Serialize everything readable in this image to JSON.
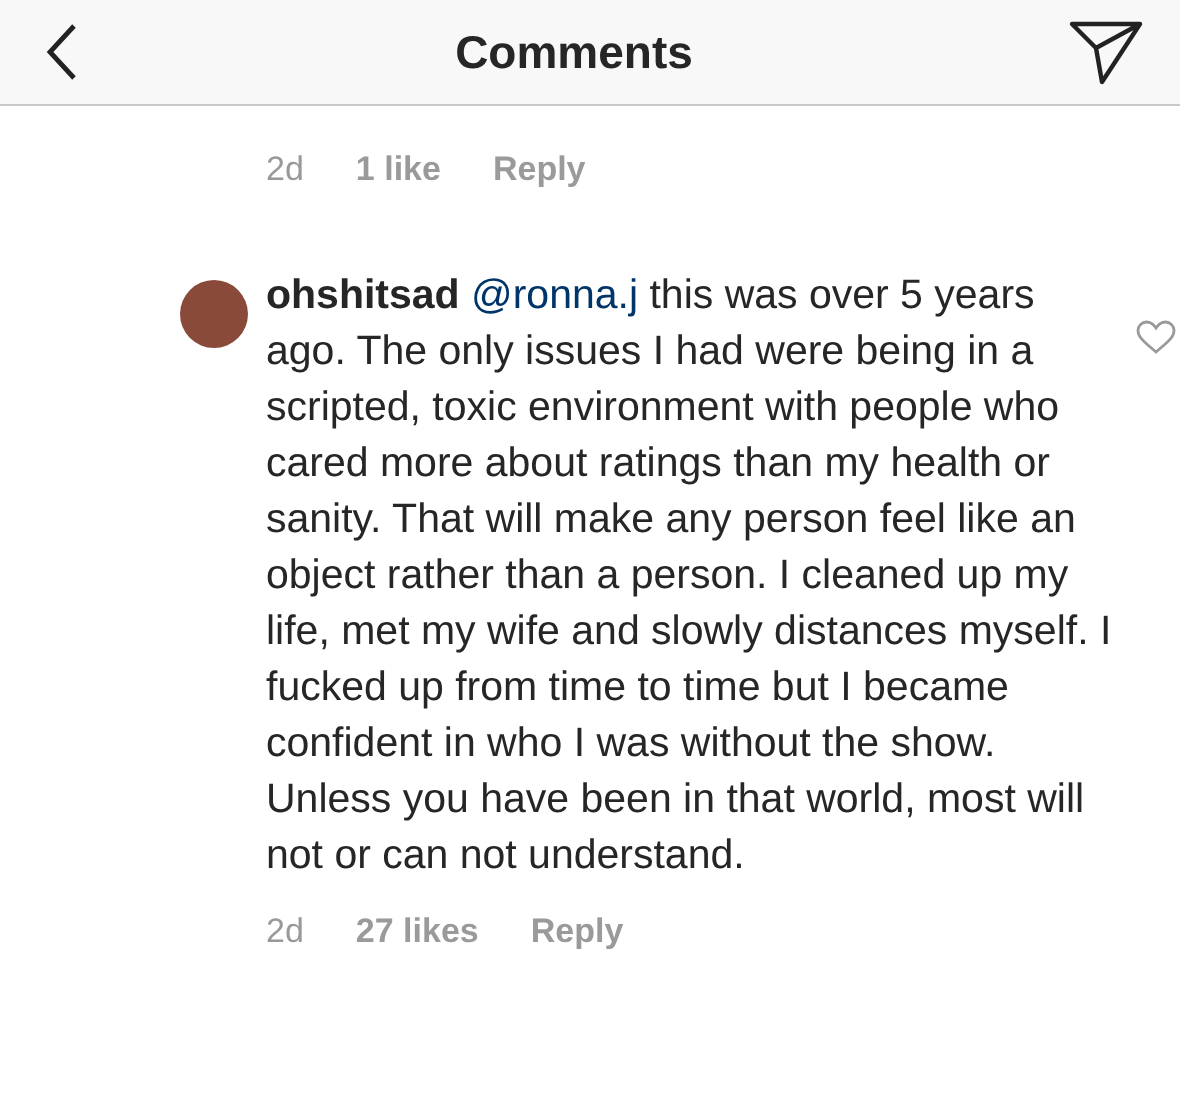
{
  "header": {
    "title": "Comments"
  },
  "comments": [
    {
      "kind": "partial",
      "time": "2d",
      "likes": "1 like",
      "reply": "Reply"
    },
    {
      "kind": "full",
      "username": "ohshitsad",
      "mention": "@ronna.j",
      "text": "this was over 5 years ago. The only issues I had were being in a scripted, toxic environment with people who cared more about ratings than my health or sanity. That will make any person feel like an object rather than a person. I cleaned up my life, met my wife and slowly distances myself. I fucked up from time to time but I became confident in who I was without the show. Unless you have been in that world, most will not or can not understand.",
      "time": "2d",
      "likes": "27 likes",
      "reply": "Reply",
      "liked": false
    }
  ]
}
